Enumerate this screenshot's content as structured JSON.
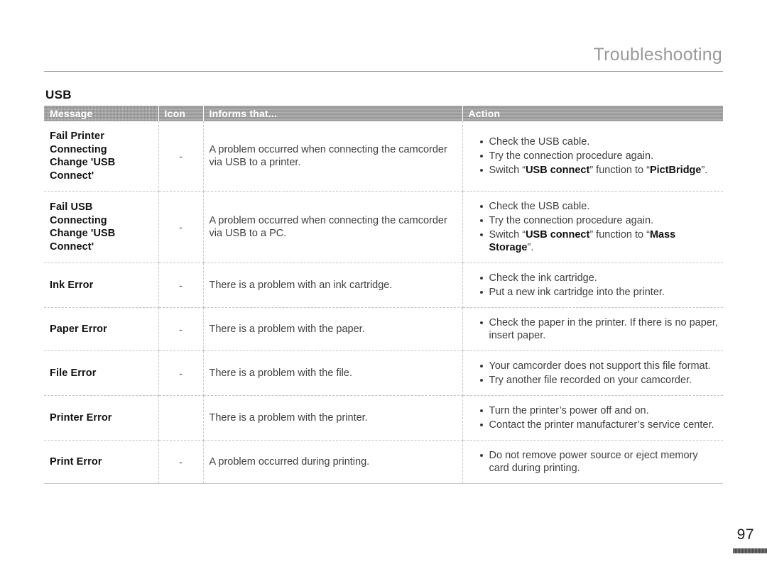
{
  "header": {
    "chapter_title": "Troubleshooting"
  },
  "section": {
    "label": "USB"
  },
  "table": {
    "columns": [
      "Message",
      "Icon",
      "Informs that...",
      "Action"
    ],
    "rows": [
      {
        "message": "Fail Printer\nConnecting\nChange 'USB\nConnect'",
        "icon": "-",
        "informs": "A problem occurred when connecting the camcorder via USB to a printer.",
        "actions": [
          {
            "parts": [
              {
                "t": "Check the USB cable.",
                "bold": false
              }
            ]
          },
          {
            "parts": [
              {
                "t": "Try the connection procedure again.",
                "bold": false
              }
            ]
          },
          {
            "parts": [
              {
                "t": "Switch “",
                "bold": false
              },
              {
                "t": "USB connect",
                "bold": true
              },
              {
                "t": "” function to “",
                "bold": false
              },
              {
                "t": "PictBridge",
                "bold": true
              },
              {
                "t": "”.",
                "bold": false
              }
            ]
          }
        ]
      },
      {
        "message": "Fail USB\nConnecting\nChange 'USB\nConnect'",
        "icon": "-",
        "informs": "A problem occurred when connecting the camcorder via USB to a PC.",
        "actions": [
          {
            "parts": [
              {
                "t": "Check the USB cable.",
                "bold": false
              }
            ]
          },
          {
            "parts": [
              {
                "t": "Try the connection procedure again.",
                "bold": false
              }
            ]
          },
          {
            "parts": [
              {
                "t": "Switch “",
                "bold": false
              },
              {
                "t": "USB connect",
                "bold": true
              },
              {
                "t": "” function to “",
                "bold": false
              },
              {
                "t": "Mass Storage",
                "bold": true
              },
              {
                "t": "”.",
                "bold": false
              }
            ]
          }
        ]
      },
      {
        "message": "Ink Error",
        "icon": "-",
        "informs": "There is a problem with an ink cartridge.",
        "actions": [
          {
            "parts": [
              {
                "t": "Check the ink cartridge.",
                "bold": false
              }
            ]
          },
          {
            "parts": [
              {
                "t": "Put a new ink cartridge into the printer.",
                "bold": false
              }
            ]
          }
        ]
      },
      {
        "message": "Paper Error",
        "icon": "-",
        "informs": "There is a problem with the paper.",
        "actions": [
          {
            "parts": [
              {
                "t": "Check the paper in the printer. If there is no paper, insert paper.",
                "bold": false
              }
            ]
          }
        ]
      },
      {
        "message": "File Error",
        "icon": "-",
        "informs": "There is a problem with the file.",
        "actions": [
          {
            "parts": [
              {
                "t": "Your camcorder does not support this file format.",
                "bold": false
              }
            ]
          },
          {
            "parts": [
              {
                "t": "Try another file recorded on your camcorder.",
                "bold": false
              }
            ]
          }
        ]
      },
      {
        "message": "Printer Error",
        "icon": "",
        "informs": "There is a problem with the printer.",
        "actions": [
          {
            "parts": [
              {
                "t": "Turn the printer’s power off and on.",
                "bold": false
              }
            ]
          },
          {
            "parts": [
              {
                "t": "Contact the printer manufacturer’s service center.",
                "bold": false
              }
            ]
          }
        ]
      },
      {
        "message": "Print Error",
        "icon": "-",
        "informs": "A problem occurred during printing.",
        "actions": [
          {
            "parts": [
              {
                "t": "Do not remove power source or eject memory card during printing.",
                "bold": false
              }
            ]
          }
        ]
      }
    ]
  },
  "footer": {
    "page_number": "97"
  },
  "colors": {
    "header_bar": "#9b9b9b",
    "title_gray": "#9a9a9a",
    "body_text": "#3f3f3f",
    "bold_text": "#111111",
    "rule": "#8d8d8d"
  }
}
